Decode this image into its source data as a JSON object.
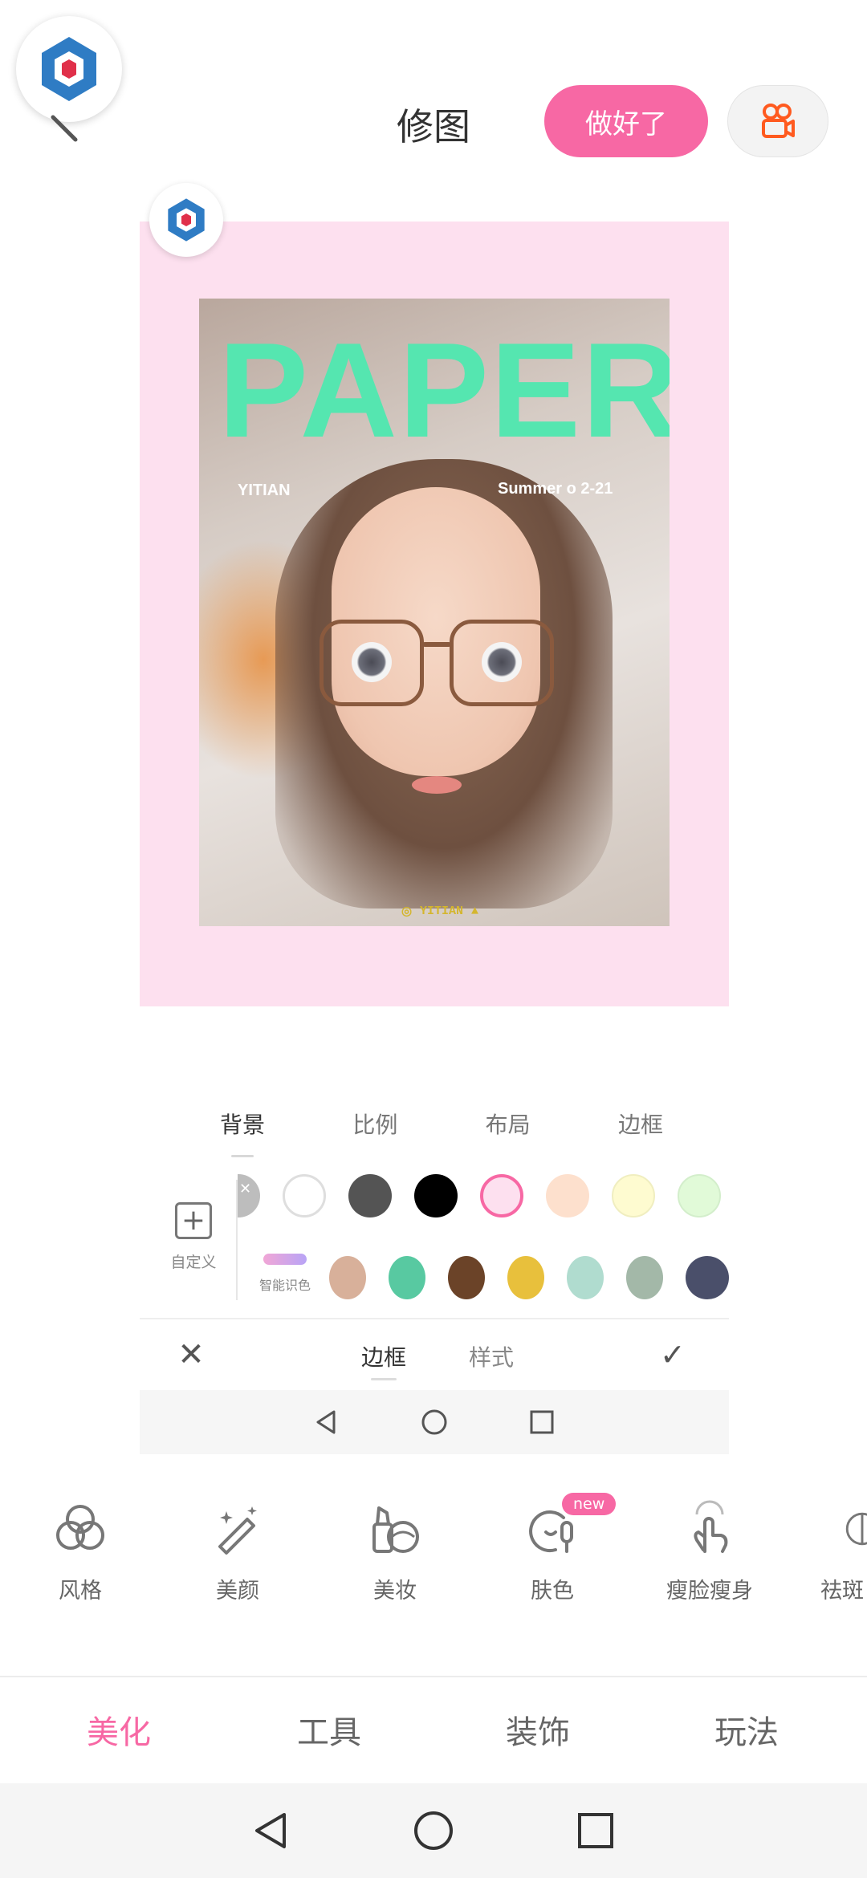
{
  "header": {
    "title": "修图",
    "done_label": "做好了",
    "app_logo_icon": "app-logo-icon",
    "video_icon": "video-camera-icon"
  },
  "canvas": {
    "background_color": "#fde0ef",
    "poster_title": "PAPER",
    "poster_left_text": "YITIAN",
    "poster_right_text": "Summer o    2-21",
    "poster_footer_text": "YITIAN"
  },
  "editor": {
    "tabs": [
      {
        "label": "背景",
        "active": true
      },
      {
        "label": "比例"
      },
      {
        "label": "布局"
      },
      {
        "label": "边框"
      }
    ],
    "custom_label": "自定义",
    "smart_color_label": "智能识色",
    "swatches_row1": [
      "#bdbdbd",
      "#ffffff",
      "#545454",
      "#000000",
      "#fde0ef",
      "#fde0cd",
      "#fefbd0",
      "#e1fad8"
    ],
    "swatches_row2": [
      "#d8b09a",
      "#58c9a1",
      "#6b4328",
      "#e8c03c",
      "#b0dccf",
      "#a3b8a8",
      "#4a4f6a"
    ],
    "selected_swatch": "#fde0ef",
    "mode_tabs": [
      {
        "label": "边框",
        "active": true
      },
      {
        "label": "样式"
      }
    ]
  },
  "tools": [
    {
      "label": "风格",
      "icon": "style-circles-icon"
    },
    {
      "label": "美颜",
      "icon": "magic-wand-icon"
    },
    {
      "label": "美妆",
      "icon": "makeup-icon"
    },
    {
      "label": "肤色",
      "icon": "skin-tone-icon",
      "badge": "new"
    },
    {
      "label": "瘦脸瘦身",
      "icon": "slim-hand-icon"
    },
    {
      "label": "祛斑",
      "icon": "spot-removal-icon"
    }
  ],
  "bottom_tabs": [
    {
      "label": "美化",
      "active": true
    },
    {
      "label": "工具"
    },
    {
      "label": "装饰"
    },
    {
      "label": "玩法"
    }
  ],
  "colors": {
    "accent": "#f768a4",
    "poster_title": "#55e6b0"
  }
}
